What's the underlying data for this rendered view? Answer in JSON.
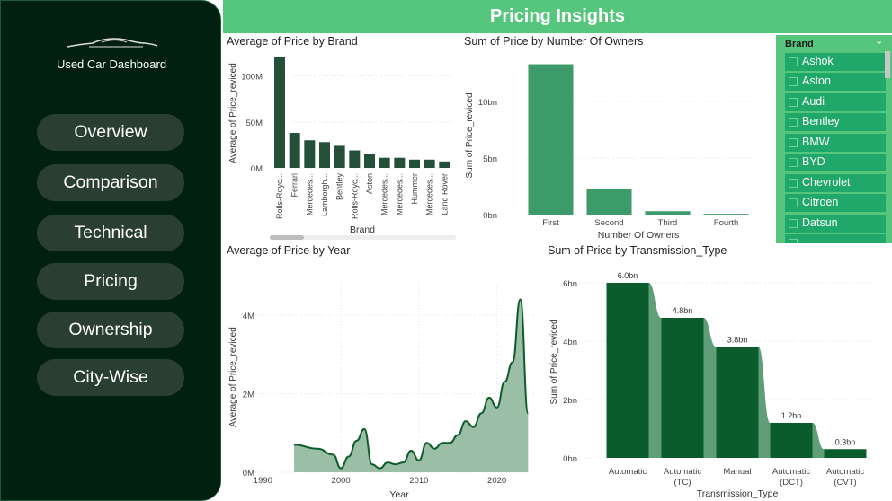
{
  "app_title": "Used Car Dashboard",
  "page_title": "Pricing Insights",
  "nav": [
    {
      "label": "Overview"
    },
    {
      "label": "Comparison"
    },
    {
      "label": "Technical"
    },
    {
      "label": "Pricing"
    },
    {
      "label": "Ownership"
    },
    {
      "label": "City-Wise"
    }
  ],
  "slicer": {
    "title": "Brand",
    "items": [
      "Ashok",
      "Aston",
      "Audi",
      "Bentley",
      "BMW",
      "BYD",
      "Chevrolet",
      "Citroen",
      "Datsun"
    ]
  },
  "colors": {
    "sidebar": "#02200f",
    "header": "#57c67d",
    "bar_dark": "#24503a",
    "bar_mid": "#3d9a6a",
    "area_fill": "#9bbfa6",
    "area_line": "#0e5b2b",
    "waterfall": "#0b5c2c",
    "waterfall_link": "#5f9e78"
  },
  "icons": {
    "logo": "car-silhouette-icon",
    "dropdown": "chevron-down-icon"
  },
  "chart_data": [
    {
      "type": "bar",
      "title": "Average of Price by Brand",
      "xlabel": "Brand",
      "ylabel": "Average of Price_reviced",
      "ylim": [
        0,
        120000000
      ],
      "yticks": [
        "0M",
        "50M",
        "100M"
      ],
      "categories": [
        "Rolls-Royc...",
        "Ferrari",
        "Mercedes...",
        "Lamborgh...",
        "Bentley",
        "Rolls-Royc...",
        "Aston",
        "Mercedes...",
        "Mercedes...",
        "Hummer",
        "Mercedes...",
        "Land Rover"
      ],
      "values": [
        120000000,
        38000000,
        30000000,
        28000000,
        24000000,
        19000000,
        15000000,
        11000000,
        11000000,
        9000000,
        9000000,
        7000000
      ]
    },
    {
      "type": "bar",
      "title": "Sum of Price by Number Of Owners",
      "xlabel": "Number Of Owners",
      "ylabel": "Sum of Price_reviced",
      "ylim": [
        0,
        13500000000
      ],
      "yticks": [
        "0bn",
        "5bn",
        "10bn"
      ],
      "categories": [
        "First",
        "Second",
        "Third",
        "Fourth"
      ],
      "values": [
        13300000000,
        2300000000,
        300000000,
        70000000
      ]
    },
    {
      "type": "area",
      "title": "Average of Price by Year",
      "xlabel": "Year",
      "ylabel": "Average of Price_reviced",
      "xlim": [
        1988,
        2025
      ],
      "ylim": [
        0,
        4800000
      ],
      "xticks": [
        "1990",
        "2000",
        "2010",
        "2020"
      ],
      "yticks": [
        "0M",
        "2M",
        "4M"
      ],
      "x": [
        1994,
        1997,
        1999,
        2000,
        2001,
        2002,
        2003,
        2004,
        2005,
        2006,
        2007,
        2008,
        2009,
        2010,
        2011,
        2012,
        2013,
        2014,
        2015,
        2016,
        2017,
        2018,
        2019,
        2020,
        2021,
        2022,
        2023,
        2024
      ],
      "y": [
        700000,
        600000,
        450000,
        100000,
        400000,
        800000,
        1100000,
        200000,
        100000,
        250000,
        200000,
        250000,
        550000,
        300000,
        750000,
        600000,
        750000,
        750000,
        950000,
        1300000,
        1150000,
        1500000,
        1900000,
        1650000,
        2300000,
        2800000,
        4400000,
        1500000
      ]
    },
    {
      "type": "bar",
      "title": "Sum of Price by Transmission_Type",
      "xlabel": "Transmission_Type",
      "ylabel": "Sum of Price_reviced",
      "ylim": [
        0,
        6000000000
      ],
      "yticks": [
        "0bn",
        "2bn",
        "4bn",
        "6bn"
      ],
      "categories": [
        "Automatic",
        "Automatic (TC)",
        "Manual",
        "Automatic (DCT)",
        "Automatic (CVT)"
      ],
      "category_lines": [
        [
          "Automatic"
        ],
        [
          "Automatic",
          "(TC)"
        ],
        [
          "Manual"
        ],
        [
          "Automatic",
          "(DCT)"
        ],
        [
          "Automatic",
          "(CVT)"
        ]
      ],
      "values": [
        6000000000,
        4800000000,
        3800000000,
        1200000000,
        300000000
      ],
      "data_labels": [
        "6.0bn",
        "4.8bn",
        "3.8bn",
        "1.2bn",
        "0.3bn"
      ]
    }
  ]
}
